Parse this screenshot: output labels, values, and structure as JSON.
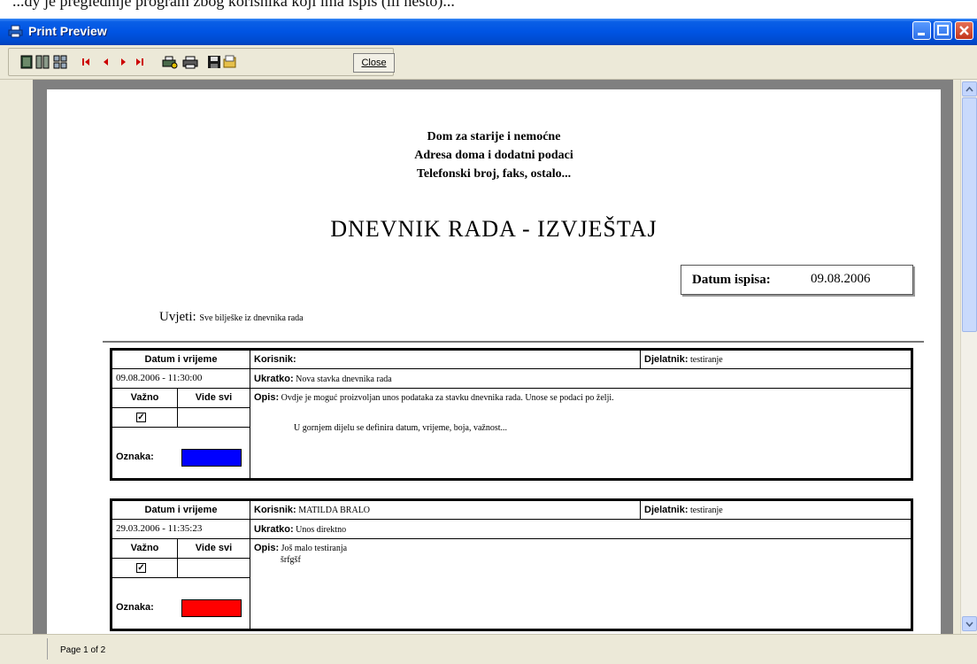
{
  "background_caption": "...dy je preglednije program zbog korisnika koji ima ispis (ili nesto)...",
  "window": {
    "title": "Print Preview",
    "colors": {
      "titlebar": "#0054e3",
      "chrome": "#ece9d8"
    }
  },
  "toolbar": {
    "icons": [
      "single-page-icon",
      "two-page-icon",
      "multi-page-icon",
      "first-page-icon",
      "previous-page-icon",
      "next-page-icon",
      "last-page-icon",
      "print-setup-icon",
      "print-icon",
      "save-icon",
      "open-icon"
    ],
    "close_label": "Close"
  },
  "report": {
    "header_lines": [
      "Dom za starije i nemoćne",
      "Adresa doma i dodatni podaci",
      "Telefonski broj, faks, ostalo..."
    ],
    "title": "DNEVNIK RADA - IZVJEŠTAJ",
    "datum_ispisa_label": "Datum ispisa:",
    "datum_ispisa_value": "09.08.2006",
    "uvjeti_label": "Uvjeti:",
    "uvjeti_value": "Sve bilješke iz dnevnika rada",
    "entries": [
      {
        "datum_label": "Datum i vrijeme",
        "datum_value": "09.08.2006 - 11:30:00",
        "korisnik_label": "Korisnik:",
        "korisnik_value": "",
        "djelatnik_label": "Djelatnik:",
        "djelatnik_value": "testiranje",
        "ukratko_label": "Ukratko:",
        "ukratko_value": "Nova stavka dnevnika rada",
        "vazno_label": "Važno",
        "vide_svi_label": "Vide svi",
        "vazno_checked": true,
        "oznaka_label": "Oznaka:",
        "oznaka_color": "#0000ff",
        "opis_label": "Opis:",
        "opis_lines": [
          "Ovdje je moguć proizvoljan unos podataka za stavku dnevnika rada. Unose se podaci po želji.",
          "U gornjem dijelu se definira datum, vrijeme, boja, važnost..."
        ]
      },
      {
        "datum_label": "Datum i vrijeme",
        "datum_value": "29.03.2006 - 11:35:23",
        "korisnik_label": "Korisnik:",
        "korisnik_value": "MATILDA BRALO",
        "djelatnik_label": "Djelatnik:",
        "djelatnik_value": "testiranje",
        "ukratko_label": "Ukratko:",
        "ukratko_value": "Unos direktno",
        "vazno_label": "Važno",
        "vide_svi_label": "Vide svi",
        "vazno_checked": true,
        "oznaka_label": "Oznaka:",
        "oznaka_color": "#ff0000",
        "opis_label": "Opis:",
        "opis_lines": [
          "Još malo testiranja",
          "šrfgšf"
        ]
      }
    ]
  },
  "status": {
    "page_text": "Page 1 of 2"
  }
}
